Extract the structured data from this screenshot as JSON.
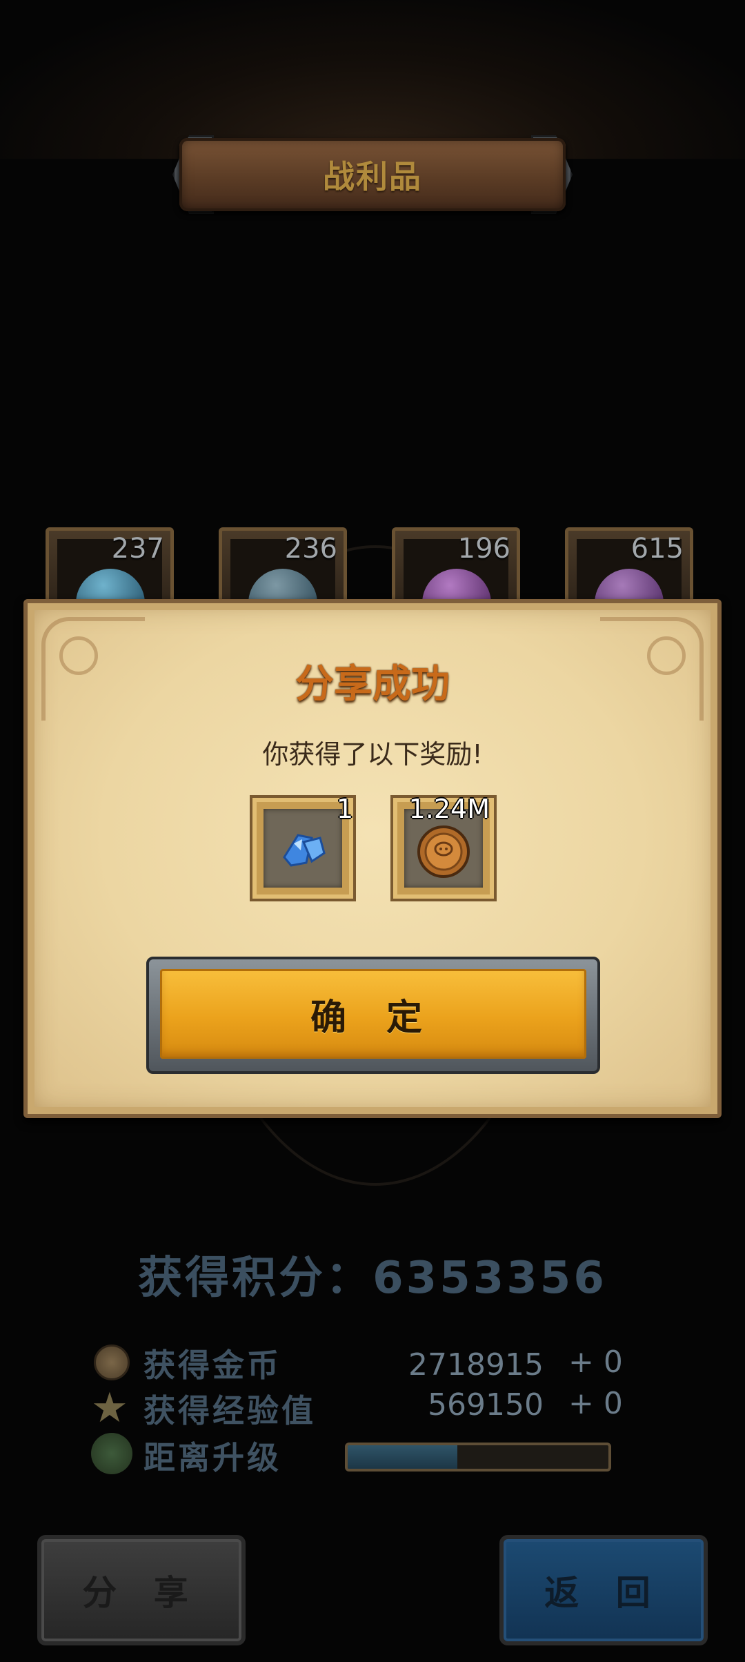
{
  "header": {
    "title": "战利品"
  },
  "loot": [
    {
      "count": "237",
      "icon": "blue-egg-icon",
      "color": "#3a6f8a"
    },
    {
      "count": "236",
      "icon": "potion-bottle-icon",
      "color": "#4a6878"
    },
    {
      "count": "196",
      "icon": "purple-flower-icon",
      "color": "#7a4a8a"
    },
    {
      "count": "615",
      "icon": "purple-jar-icon",
      "color": "#7a4a86"
    }
  ],
  "dialog": {
    "title": "分享成功",
    "subtitle": "你获得了以下奖励!",
    "rewards": [
      {
        "count": "1",
        "icon": "blue-crystal-icon"
      },
      {
        "count": "1.24M",
        "icon": "gold-coin-icon"
      }
    ],
    "confirm_label": "确 定"
  },
  "score": {
    "label": "获得积分：",
    "value": "6353356"
  },
  "stats": {
    "gold": {
      "label": "获得金币",
      "value": "2718915",
      "bonus": "+ 0"
    },
    "exp": {
      "label": "获得经验值",
      "value": "569150",
      "bonus": "+ 0"
    },
    "level": {
      "label": "距离升级",
      "progress": 0.42
    }
  },
  "buttons": {
    "share": "分 享",
    "back": "返 回"
  },
  "colors": {
    "accent": "#eba21c",
    "title": "#c86a1a"
  }
}
